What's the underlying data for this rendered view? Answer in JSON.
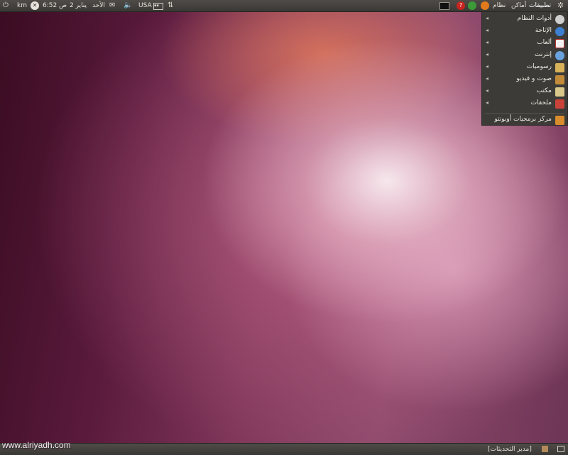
{
  "top_panel": {
    "time": "6:52 ص",
    "date": "2 يناير",
    "day": "الأحد",
    "keyboard": "USA",
    "user": "km",
    "menus": {
      "applications": "تطبيقات",
      "places": "أماكن",
      "system": "نظام"
    }
  },
  "applications_menu": {
    "items": [
      {
        "label": "أدوات النظام",
        "icon": "gear-icon",
        "color": "#cfcfcf"
      },
      {
        "label": "الإتاحة",
        "icon": "accessibility-icon",
        "color": "#3d7fd0"
      },
      {
        "label": "ألعاب",
        "icon": "cards-icon",
        "color": "#f2f2f2"
      },
      {
        "label": "إنترنت",
        "icon": "globe-icon",
        "color": "#6aa2de"
      },
      {
        "label": "رسوميات",
        "icon": "paint-icon",
        "color": "#d9b35a"
      },
      {
        "label": "صوت و فيديو",
        "icon": "media-icon",
        "color": "#c28b3a"
      },
      {
        "label": "مكتب",
        "icon": "office-icon",
        "color": "#d8c88a"
      },
      {
        "label": "ملحقات",
        "icon": "accessories-icon",
        "color": "#c9433a"
      }
    ],
    "footer": {
      "label": "مركز برمجيات أوبونتو",
      "icon": "software-center-icon",
      "color": "#d98c2e"
    }
  },
  "bottom_panel": {
    "taskbar_item": "[مدير التحديثات]"
  },
  "watermark": "www.alriyadh.com"
}
